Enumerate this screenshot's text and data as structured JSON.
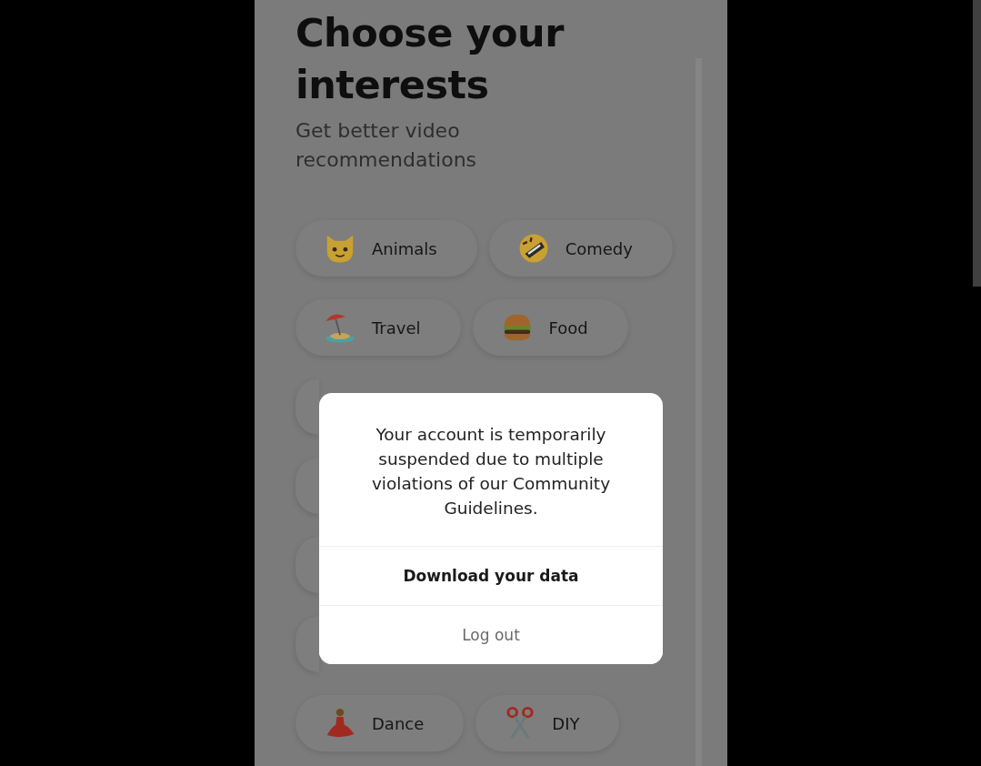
{
  "title": "Choose your interests",
  "subtitle": "Get better video recommendations",
  "interests": [
    {
      "label": "Animals",
      "kind": "cat"
    },
    {
      "label": "Comedy",
      "kind": "laugh"
    },
    {
      "label": "Travel",
      "kind": "island"
    },
    {
      "label": "Food",
      "kind": "burger"
    },
    {
      "label": "Dance",
      "kind": "dancer"
    },
    {
      "label": "DIY",
      "kind": "scissors"
    }
  ],
  "dialog": {
    "message": "Your account is temporarily suspended due to multiple violations of our Community Guidelines.",
    "actions": [
      {
        "label": "Download your data",
        "kind": "primary"
      },
      {
        "label": "Log out",
        "kind": "secondary"
      }
    ]
  }
}
